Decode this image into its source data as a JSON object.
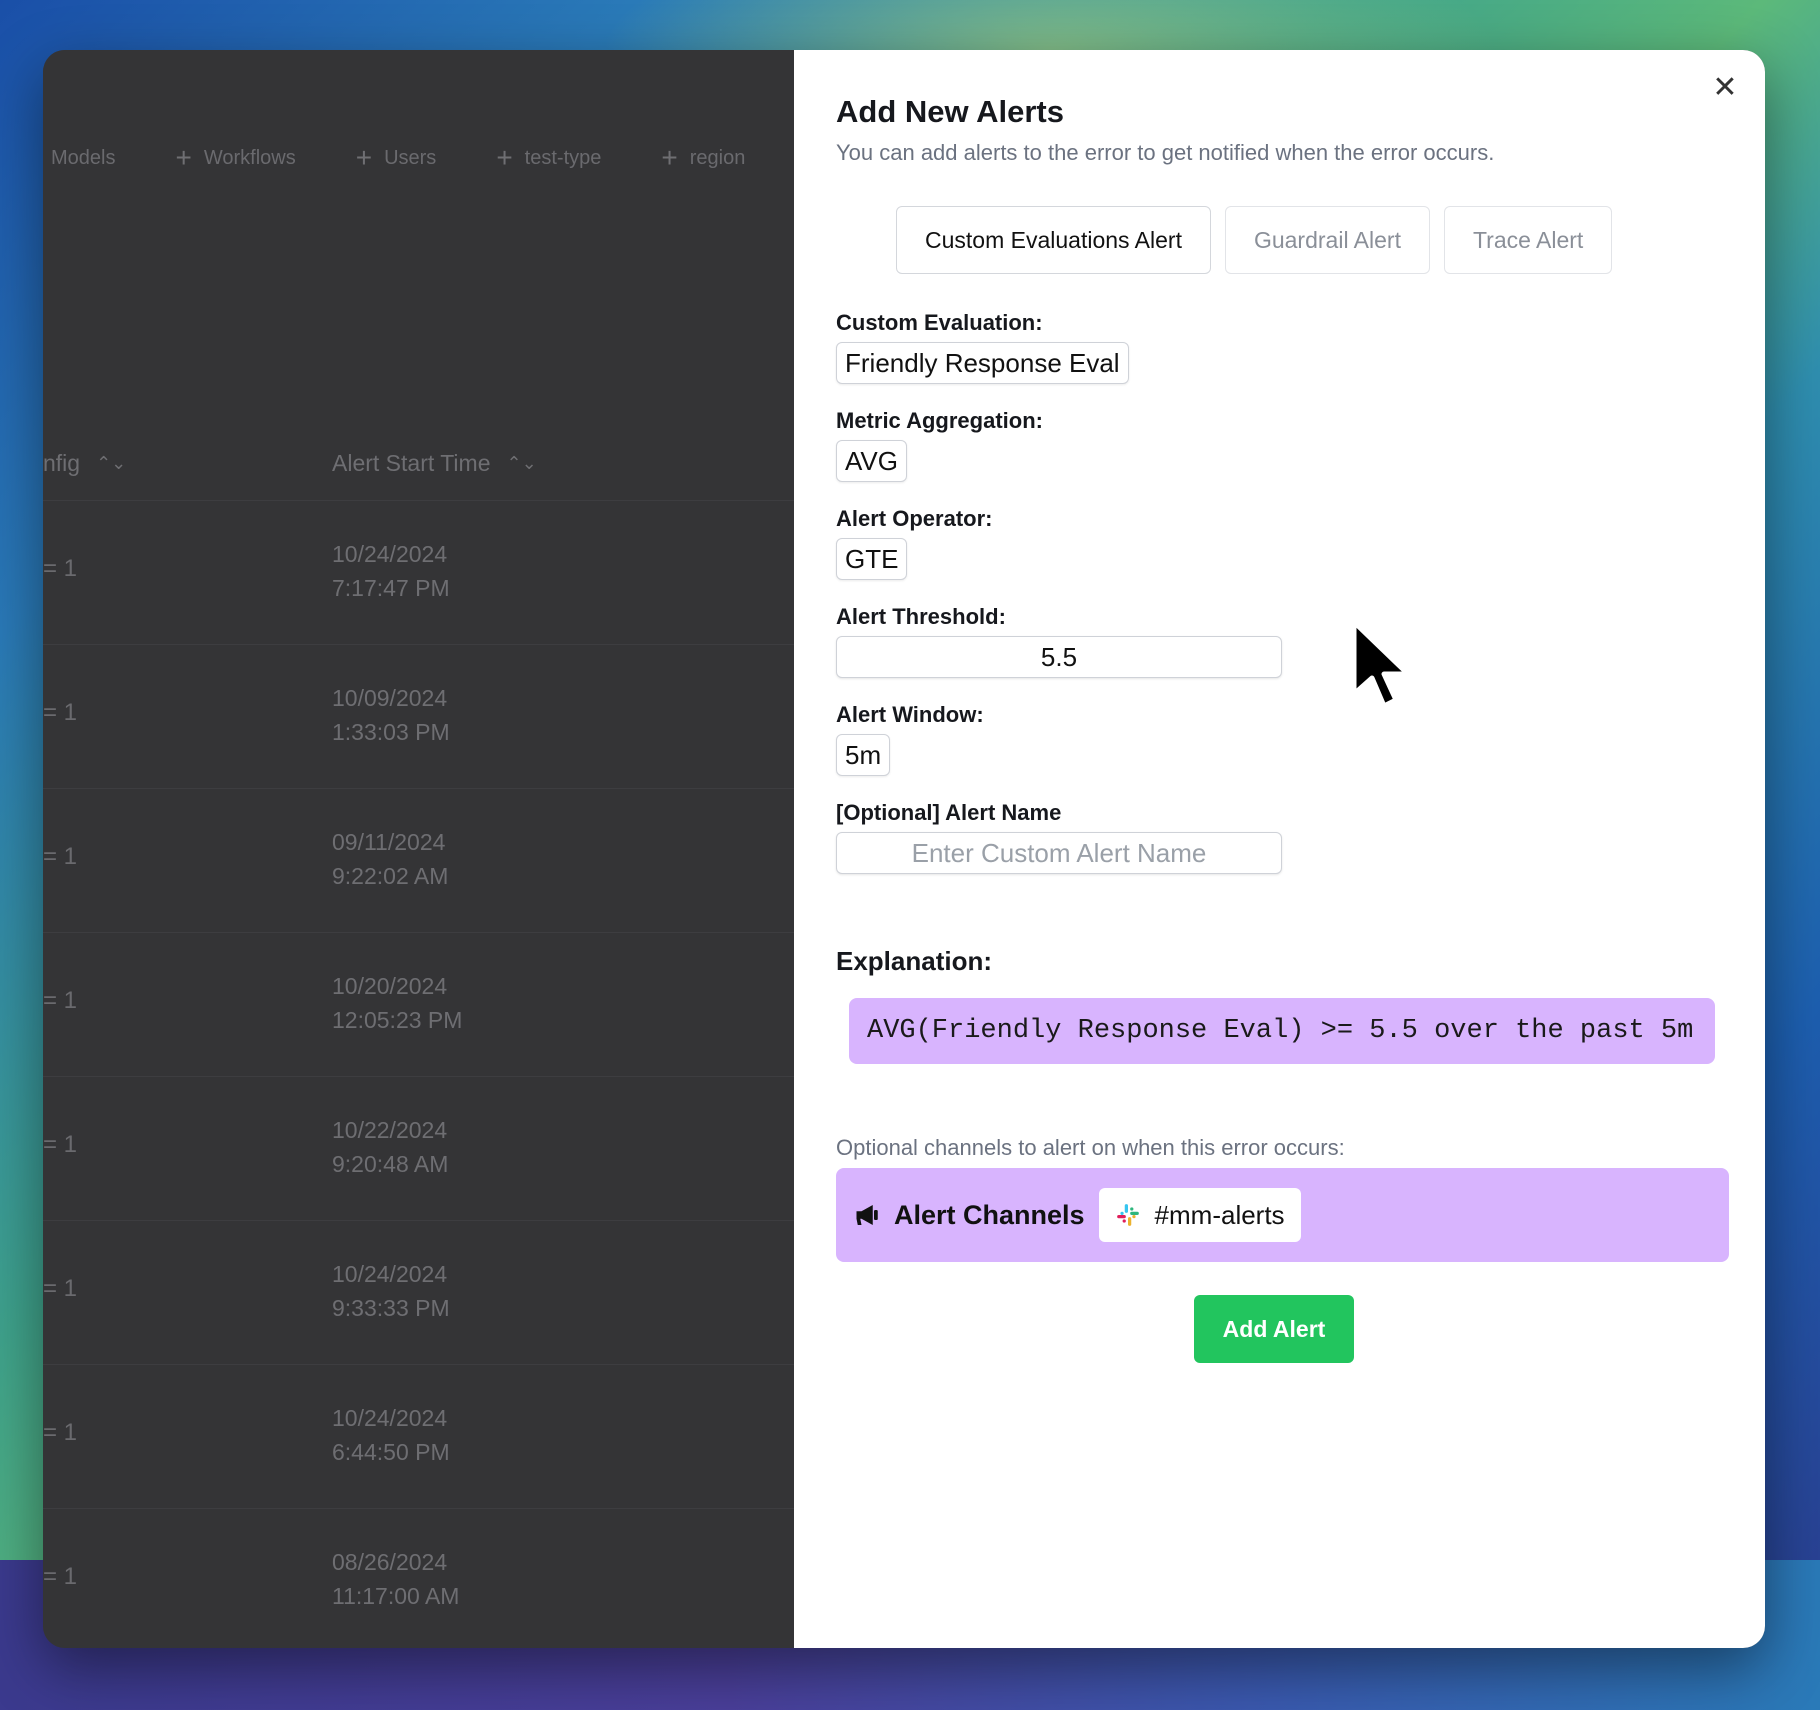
{
  "background_app": {
    "filters": [
      "Models",
      "Workflows",
      "Users",
      "test-type",
      "region"
    ],
    "columns": {
      "config_partial": "nfig",
      "alert_start_time": "Alert Start Time"
    },
    "rows": [
      {
        "eq": "= 1",
        "date": "10/24/2024",
        "time": "7:17:47 PM"
      },
      {
        "eq": "= 1",
        "date": "10/09/2024",
        "time": "1:33:03 PM"
      },
      {
        "eq": "= 1",
        "date": "09/11/2024",
        "time": "9:22:02 AM"
      },
      {
        "eq": "= 1",
        "date": "10/20/2024",
        "time": "12:05:23 PM"
      },
      {
        "eq": "= 1",
        "date": "10/22/2024",
        "time": "9:20:48 AM"
      },
      {
        "eq": "= 1",
        "date": "10/24/2024",
        "time": "9:33:33 PM"
      },
      {
        "eq": "= 1",
        "date": "10/24/2024",
        "time": "6:44:50 PM"
      },
      {
        "eq": "= 1",
        "date": "08/26/2024",
        "time": "11:17:00 AM"
      }
    ]
  },
  "modal": {
    "title": "Add New Alerts",
    "subtitle": "You can add alerts to the error to get notified when the error occurs.",
    "close_icon": "close-icon",
    "tabs": [
      {
        "label": "Custom Evaluations Alert",
        "active": true
      },
      {
        "label": "Guardrail Alert",
        "active": false
      },
      {
        "label": "Trace Alert",
        "active": false
      }
    ],
    "custom_evaluation": {
      "label": "Custom Evaluation:",
      "value": "Friendly Response Eval"
    },
    "metric_aggregation": {
      "label": "Metric Aggregation:",
      "value": "AVG"
    },
    "alert_operator": {
      "label": "Alert Operator:",
      "value": "GTE"
    },
    "alert_threshold": {
      "label": "Alert Threshold:",
      "value": "5.5"
    },
    "alert_window": {
      "label": "Alert Window:",
      "value": "5m"
    },
    "alert_name": {
      "label": "[Optional] Alert Name",
      "placeholder": "Enter Custom Alert Name"
    },
    "explanation": {
      "label": "Explanation:",
      "text": "AVG(Friendly Response Eval) >= 5.5 over the past 5m"
    },
    "channels": {
      "hint": "Optional channels to alert on when this error occurs:",
      "title": "Alert Channels",
      "icon": "megaphone-icon",
      "selected": "#mm-alerts",
      "selected_icon": "slack-icon"
    },
    "add_button": "Add Alert"
  },
  "colors": {
    "accent_purple": "#d8b4fe",
    "button_green": "#22c55e"
  }
}
